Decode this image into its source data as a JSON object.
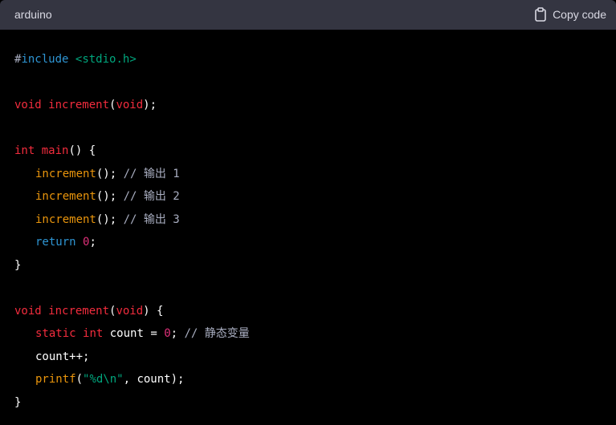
{
  "header": {
    "language": "arduino",
    "copy_label": "Copy code"
  },
  "code": {
    "l1": {
      "hash": "#",
      "directive": "include",
      "header": "<stdio.h>"
    },
    "l2": {
      "type": "void",
      "name": "increment",
      "open": "(",
      "arg": "void",
      "close": ");"
    },
    "l3": {
      "type": "int",
      "name": "main",
      "rest": "() {"
    },
    "l4": {
      "call": "increment",
      "rest": "(); ",
      "comment": "// 输出 1"
    },
    "l5": {
      "call": "increment",
      "rest": "(); ",
      "comment": "// 输出 2"
    },
    "l6": {
      "call": "increment",
      "rest": "(); ",
      "comment": "// 输出 3"
    },
    "l7": {
      "kw": "return",
      "num": "0",
      "semi": ";"
    },
    "l8": {
      "brace": "}"
    },
    "l9": {
      "type": "void",
      "name": "increment",
      "open": "(",
      "arg": "void",
      "close": ") {"
    },
    "l10": {
      "kw1": "static",
      "kw2": "int",
      "var": "count",
      "eq": " = ",
      "num": "0",
      "semi": "; ",
      "comment": "// 静态变量"
    },
    "l11": {
      "text": "count++;"
    },
    "l12": {
      "fn": "printf",
      "open": "(",
      "str": "\"%d\\n\"",
      "rest": ", count);"
    },
    "l13": {
      "brace": "}"
    }
  },
  "colors": {
    "header_bg": "#343541",
    "code_bg": "#000000",
    "keyword": "#f22c3d",
    "string": "#00a67d",
    "function": "#e9950c",
    "comment": "#a9aec1",
    "directive": "#2e95d3"
  },
  "icons": {
    "copy": "clipboard-icon"
  }
}
